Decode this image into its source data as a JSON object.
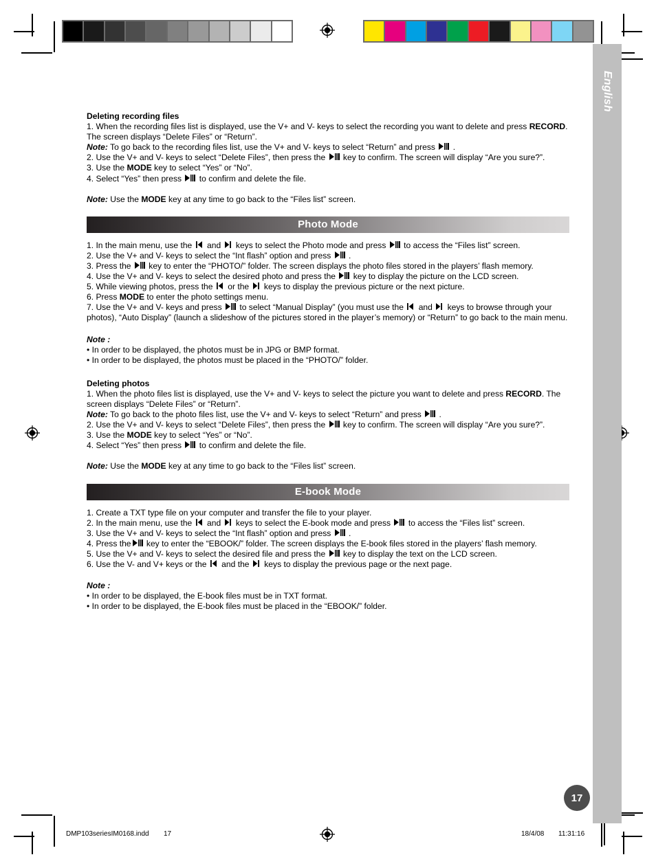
{
  "page": {
    "language_label": "English",
    "page_number": "17"
  },
  "footer": {
    "file_name": "DMP103seriesIM0168.indd",
    "page_number": "17",
    "date": "18/4/08",
    "time": "11:31:16"
  },
  "calibration": {
    "gray_bar_label": "grayscale-calibration-bar",
    "gray_swatches": [
      "#000000",
      "#1a1a1a",
      "#333333",
      "#4d4d4d",
      "#666666",
      "#808080",
      "#999999",
      "#b3b3b3",
      "#cccccc",
      "#ebebeb",
      "#ffffff"
    ],
    "color_bar_label": "color-calibration-bar",
    "color_swatches": [
      "#ffe600",
      "#e6007e",
      "#00a0e3",
      "#2e3192",
      "#00a14b",
      "#ed1c24",
      "#1a1a1a",
      "#fbf38c",
      "#f291c0",
      "#7ed6f5",
      "#939393"
    ]
  },
  "sections": {
    "deleting_recording_files": {
      "heading": "Deleting recording files",
      "lines": [
        "1. When the recording files list is displayed, use the V+ and V- keys to select the recording you want to delete and press RECORD. The screen displays “Delete Files” or “Return”.",
        "Note: To go back to the recording files list, use the V+ and V- keys to select “Return” and press [play-pause] .",
        "2. Use the V+ and V- keys to select “Delete Files”, then press the [play-pause] key to confirm. The screen will display “Are you sure?”.",
        "3. Use the MODE key to select “Yes” or “No”.",
        "4. Select “Yes” then press [play-pause] to confirm and delete the file."
      ],
      "closing_note": "Note: Use the MODE key at any time to go back to the “Files list” screen."
    },
    "photo_mode": {
      "banner_title": "Photo Mode",
      "lines": [
        "1. In the main menu, use the [prev] and [next] keys to select the Photo mode and press [play-pause] to access the “Files list” screen.",
        "2. Use the V+ and V- keys to select the “Int flash” option and press [play-pause] .",
        "3. Press the [play-pause] key to enter the “PHOTO/” folder. The screen displays the photo files stored in the players’ flash memory.",
        "4. Use the V+ and V- keys to select the desired photo and press the [play-pause] key to display the picture on the LCD screen.",
        "5. While viewing photos, press the [prev] or the [next] keys to display the previous picture or the next picture.",
        "6. Press MODE to enter the photo settings menu.",
        "7. Use the V+ and V- keys and press [play-pause] to select “Manual Display” (you must use the [prev] and [next] keys to browse through your photos), “Auto Display” (launch a slideshow of the pictures stored in the player’s memory) or “Return” to go back to the main menu."
      ],
      "note_label": "Note :",
      "note_bullets": [
        "• In order to be displayed, the photos must be in JPG or BMP format.",
        "• In order to be displayed, the photos must be placed in the “PHOTO/” folder."
      ]
    },
    "deleting_photos": {
      "heading": "Deleting photos",
      "lines": [
        "1. When the photo files list is displayed, use the V+ and V- keys to select the picture you want to delete and press RECORD. The screen displays “Delete Files” or “Return”.",
        "Note: To go back to the photo files list, use the V+ and V- keys to select “Return” and press [play-pause] .",
        "2. Use the V+ and V- keys to select “Delete Files”, then press the [play-pause] key to confirm. The screen will display “Are you sure?”.",
        "3. Use the MODE key to select “Yes” or “No”.",
        "4. Select “Yes” then press [play-pause] to confirm and delete the file."
      ],
      "closing_note": "Note: Use the MODE key at any time to go back to the “Files list” screen."
    },
    "ebook_mode": {
      "banner_title": "E-book Mode",
      "lines": [
        "1. Create a TXT type file on your computer and transfer the file to your player.",
        "2. In the main menu, use the [prev] and [next] keys to select the E-book mode and press [play-pause] to access the “Files list” screen.",
        "3. Use the V+ and V- keys to select the “Int flash” option and press [play-pause] .",
        "4. Press the [play-pause] key to enter the “EBOOK/” folder. The screen displays the E-book files stored in the players’ flash memory.",
        "5. Use the V+ and V- keys to select the desired file and press the [play-pause] key to display the text on the LCD screen.",
        "6. Use the V- and V+ keys or the [prev] and the [next] keys to display the previous page or the next page."
      ],
      "note_label": "Note :",
      "note_bullets": [
        "• In order to be displayed, the E-book files must be in TXT format.",
        "• In order to be displayed, the E-book files must be placed in the “EBOOK/” folder."
      ]
    }
  },
  "text_fragments": {
    "drf_head": "Deleting recording files",
    "drf_1a": "1. When the recording files list is displayed, use the V+ and V- keys to select the recording you want to delete and press ",
    "drf_1b": "RECORD",
    "drf_1c": ". The screen displays “Delete Files” or “Return”.",
    "drf_note_label": "Note:",
    "drf_note_a": " To go back to the recording files list, use the V+ and V- keys to select “Return” and press ",
    "drf_note_b": " .",
    "drf_2a": "2. Use the V+ and V- keys to select “Delete Files”, then press the ",
    "drf_2b": " key to confirm. The screen will display “Are you sure?”.",
    "drf_3a": "3. Use the ",
    "drf_3b": "MODE",
    "drf_3c": " key to select “Yes” or “No”.",
    "drf_4a": "4. Select “Yes” then press ",
    "drf_4b": " to confirm and delete the file.",
    "close_note_label": "Note:",
    "close_note_a": " Use the ",
    "close_note_b": "MODE",
    "close_note_c": " key at any time to go back to the “Files list” screen.",
    "pm_banner": "Photo Mode",
    "pm_1a": "1. In the main menu, use the ",
    "pm_1b": " and ",
    "pm_1c": " keys to select the Photo mode and press ",
    "pm_1d": " to access the “Files list” screen.",
    "pm_2a": "2. Use the V+ and V- keys to select the “Int flash” option and press ",
    "pm_2b": " .",
    "pm_3a": "3. Press the ",
    "pm_3b": " key to enter the “PHOTO/” folder. The screen displays the photo files stored in the players’ flash memory.",
    "pm_4a": "4. Use the V+ and V- keys to select the desired photo and press the ",
    "pm_4b": " key to display the picture on the LCD screen.",
    "pm_5a": "5. While viewing photos, press the ",
    "pm_5b": " or the ",
    "pm_5c": " keys to display the previous picture or the next picture.",
    "pm_6a": "6. Press ",
    "pm_6b": "MODE",
    "pm_6c": " to enter the photo settings menu.",
    "pm_7a": "7. Use the V+ and V- keys and press ",
    "pm_7b": " to select “Manual Display” (you must use the ",
    "pm_7c": " and ",
    "pm_7d": " keys to browse through your photos), “Auto Display” (launch a slideshow of the pictures stored in the player’s memory) or “Return” to go back to the main menu.",
    "pm_note_label": "Note :",
    "pm_bullet1": "• In order to be displayed, the photos must be in JPG or BMP format.",
    "pm_bullet2": "• In order to be displayed, the photos must be placed in the “PHOTO/” folder.",
    "dp_head": "Deleting photos",
    "dp_1a": "1. When the photo files list is displayed, use the V+ and V- keys to select the picture you want to delete and press ",
    "dp_1b": "RECORD",
    "dp_1c": ". The screen displays “Delete Files” or “Return”.",
    "dp_note_label": "Note:",
    "dp_note_a": " To go back to the photo files list, use the V+ and V- keys to select “Return” and press ",
    "dp_note_b": " .",
    "dp_2a": "2. Use the V+ and V- keys to select “Delete Files”, then press the ",
    "dp_2b": " key to confirm. The screen will display “Are you sure?”.",
    "dp_3a": "3. Use the ",
    "dp_3b": "MODE",
    "dp_3c": " key to select “Yes” or “No”.",
    "dp_4a": "4. Select “Yes” then press ",
    "dp_4b": " to confirm and delete the file.",
    "eb_banner": "E-book Mode",
    "eb_1": "1. Create a TXT type file on your computer and transfer the file to your player.",
    "eb_2a": "2. In the main menu, use the ",
    "eb_2b": " and ",
    "eb_2c": " keys to select the E-book mode and press ",
    "eb_2d": " to access the “Files list” screen.",
    "eb_3a": "3. Use the V+ and V- keys to select the “Int flash” option and press ",
    "eb_3b": " .",
    "eb_4a": "4. Press the",
    "eb_4b": " key to enter the “EBOOK/” folder. The screen displays the E-book files stored in the players’ flash memory.",
    "eb_5a": "5. Use the V+ and V- keys to select the desired file and press the ",
    "eb_5b": " key to display the text on the LCD screen.",
    "eb_6a": "6. Use the V- and V+ keys or the ",
    "eb_6b": " and the ",
    "eb_6c": " keys to display the previous page or the next page.",
    "eb_note_label": "Note :",
    "eb_bullet1": "• In order to be displayed, the E-book files must be in TXT format.",
    "eb_bullet2": "• In order to be displayed, the E-book files must be placed in the “EBOOK/” folder."
  },
  "icons": {
    "play_pause": "play-pause-icon",
    "prev": "previous-track-icon",
    "next": "next-track-icon",
    "registration": "registration-target-icon"
  }
}
